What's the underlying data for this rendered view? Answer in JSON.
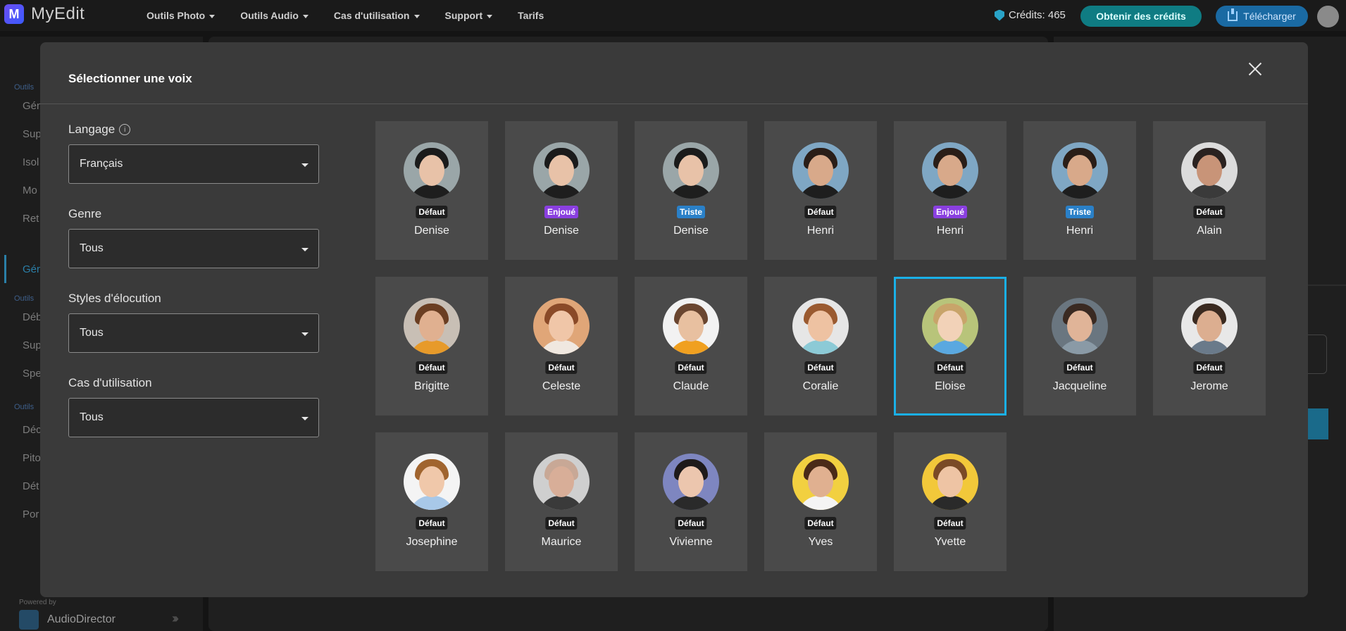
{
  "app": {
    "logo_letter": "M",
    "name": "MyEdit"
  },
  "nav": [
    {
      "label": "Outils Photo",
      "dropdown": true
    },
    {
      "label": "Outils Audio",
      "dropdown": true
    },
    {
      "label": "Cas d'utilisation",
      "dropdown": true
    },
    {
      "label": "Support",
      "dropdown": true
    },
    {
      "label": "Tarifs",
      "dropdown": false
    }
  ],
  "header": {
    "credits": "Crédits: 465",
    "get_credits": "Obtenir des crédits",
    "download": "Télécharger"
  },
  "sidebar_bg": {
    "items": [
      "Outils",
      "Gén",
      "Sup",
      "Isol",
      "Mo",
      "Ret",
      "Gén",
      "Outils",
      "Déb",
      "Sup",
      "Spe",
      "Outils",
      "Déc",
      "Pito",
      "Dét",
      "Por"
    ],
    "powered_by": "Powered by",
    "product": "AudioDirector"
  },
  "modal": {
    "title": "Sélectionner une voix",
    "filters": {
      "language": {
        "label": "Langage",
        "value": "Français"
      },
      "gender": {
        "label": "Genre",
        "value": "Tous"
      },
      "style": {
        "label": "Styles d'élocution",
        "value": "Tous"
      },
      "usecase": {
        "label": "Cas d'utilisation",
        "value": "Tous"
      }
    },
    "voices": [
      {
        "name": "Denise",
        "tag": "Défaut",
        "tag_type": "default",
        "skin": "#e8c2a8",
        "hair": "#1b1b1b",
        "bg": "#9aa6a8",
        "shirt": "#1e1e1e"
      },
      {
        "name": "Denise",
        "tag": "Enjoué",
        "tag_type": "playful",
        "skin": "#e8c2a8",
        "hair": "#1b1b1b",
        "bg": "#9aa6a8",
        "shirt": "#1e1e1e"
      },
      {
        "name": "Denise",
        "tag": "Triste",
        "tag_type": "sad",
        "skin": "#e8c2a8",
        "hair": "#1b1b1b",
        "bg": "#9aa6a8",
        "shirt": "#1e1e1e"
      },
      {
        "name": "Henri",
        "tag": "Défaut",
        "tag_type": "default",
        "skin": "#d8a98a",
        "hair": "#2a1e18",
        "bg": "#7fa7c4",
        "shirt": "#1e1e1e"
      },
      {
        "name": "Henri",
        "tag": "Enjoué",
        "tag_type": "playful",
        "skin": "#d8a98a",
        "hair": "#2a1e18",
        "bg": "#7fa7c4",
        "shirt": "#1e1e1e"
      },
      {
        "name": "Henri",
        "tag": "Triste",
        "tag_type": "sad",
        "skin": "#d8a98a",
        "hair": "#2a1e18",
        "bg": "#7fa7c4",
        "shirt": "#1e1e1e"
      },
      {
        "name": "Alain",
        "tag": "Défaut",
        "tag_type": "default",
        "skin": "#c89478",
        "hair": "#2a2220",
        "bg": "#dcdcdc",
        "shirt": "#3a3a3a"
      },
      {
        "name": "Brigitte",
        "tag": "Défaut",
        "tag_type": "default",
        "skin": "#e0b090",
        "hair": "#6a3e22",
        "bg": "#c8bfb5",
        "shirt": "#e79a2a"
      },
      {
        "name": "Celeste",
        "tag": "Défaut",
        "tag_type": "default",
        "skin": "#f0c6a8",
        "hair": "#8a4a28",
        "bg": "#e0a678",
        "shirt": "#f0e8e0"
      },
      {
        "name": "Claude",
        "tag": "Défaut",
        "tag_type": "default",
        "skin": "#e8c0a0",
        "hair": "#6a4630",
        "bg": "#f2f2f2",
        "shirt": "#f0a020"
      },
      {
        "name": "Coralie",
        "tag": "Défaut",
        "tag_type": "default",
        "skin": "#eec2a2",
        "hair": "#9a5a30",
        "bg": "#e6e6e6",
        "shirt": "#8ccad6"
      },
      {
        "name": "Eloise",
        "tag": "Défaut",
        "tag_type": "default",
        "skin": "#f2d2b8",
        "hair": "#c8a46a",
        "bg": "#b8c47a",
        "shirt": "#5aa8e0"
      },
      {
        "name": "Jacqueline",
        "tag": "Défaut",
        "tag_type": "default",
        "skin": "#e0b498",
        "hair": "#3a2a22",
        "bg": "#6a7680",
        "shirt": "#8a9aa6"
      },
      {
        "name": "Jerome",
        "tag": "Défaut",
        "tag_type": "default",
        "skin": "#dcae90",
        "hair": "#3a2a20",
        "bg": "#e8e8e8",
        "shirt": "#6a7a8a"
      },
      {
        "name": "Josephine",
        "tag": "Défaut",
        "tag_type": "default",
        "skin": "#f0c8aa",
        "hair": "#a0642e",
        "bg": "#f4f4f4",
        "shirt": "#a8c8e8"
      },
      {
        "name": "Maurice",
        "tag": "Défaut",
        "tag_type": "default",
        "skin": "#d8ae98",
        "hair": "#c8a896",
        "bg": "#cfcfcf",
        "shirt": "#3a3a3a"
      },
      {
        "name": "Vivienne",
        "tag": "Défaut",
        "tag_type": "default",
        "skin": "#ecc6ae",
        "hair": "#1e1a1a",
        "bg": "#7e86c0",
        "shirt": "#2a2a2a"
      },
      {
        "name": "Yves",
        "tag": "Défaut",
        "tag_type": "default",
        "skin": "#e0b090",
        "hair": "#4a2a18",
        "bg": "#f2d040",
        "shirt": "#f4f4f4"
      },
      {
        "name": "Yvette",
        "tag": "Défaut",
        "tag_type": "default",
        "skin": "#eec4a4",
        "hair": "#7a4a26",
        "bg": "#f2c83a",
        "shirt": "#2a2a2a"
      }
    ],
    "selected_index": 11
  },
  "colors": {
    "accent": "#1ab0e8",
    "tag_default": "#1e1e1e",
    "tag_playful": "#8a3fe0",
    "tag_sad": "#2a80c8",
    "get_credits_bg": "#0f7c83",
    "download_bg": "#1a6aa3"
  }
}
